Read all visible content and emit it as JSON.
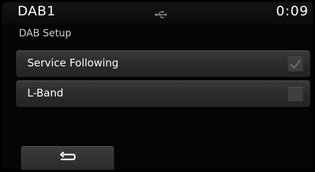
{
  "status_bar": {
    "title": "DAB1",
    "usb_icon": "usb-icon",
    "time": "0:09"
  },
  "page": {
    "subtitle": "DAB Setup"
  },
  "settings": [
    {
      "label": "Service Following",
      "checked": true
    },
    {
      "label": "L-Band",
      "checked": false
    }
  ],
  "footer": {
    "back_icon": "return-arrow-icon"
  }
}
